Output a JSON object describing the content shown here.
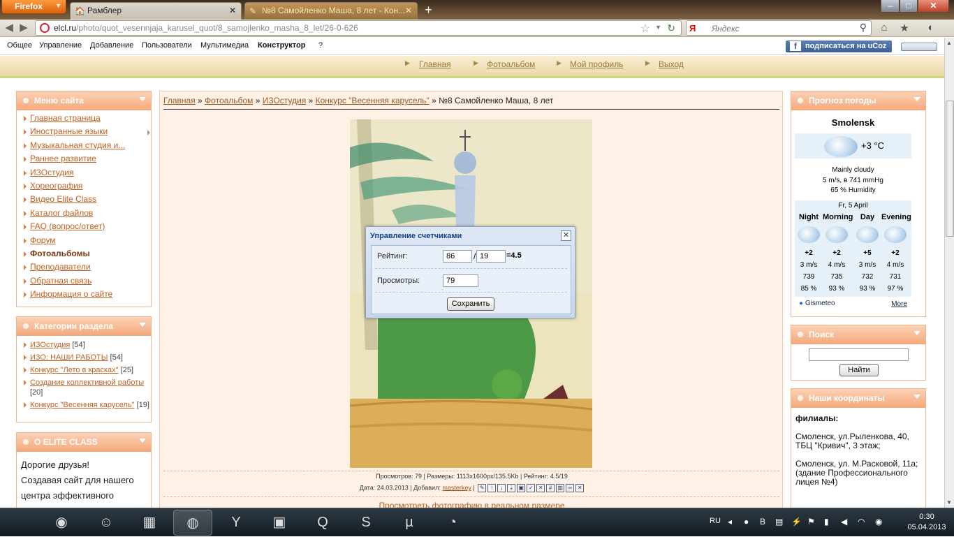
{
  "browser": {
    "menu_button": "Firefox",
    "tabs": [
      {
        "title": "Рамблер",
        "active": false
      },
      {
        "title": "№8 Самойленко Маша, 8 лет - Кон...",
        "active": true
      }
    ],
    "url_domain": "elcl.ru",
    "url_path": "/photo/quot_vesennjaja_karusel_quot/8_samojlenko_masha_8_let/26-0-626",
    "search_placeholder": "Яндекс",
    "search_engine_logo": "Я"
  },
  "ucoz_bar": {
    "items": [
      "Общее",
      "Управление",
      "Добавление",
      "Пользователи",
      "Мультимедиа",
      "Конструктор",
      "?"
    ],
    "subscribe": "подписаться на uCoz"
  },
  "site_nav": [
    "Главная",
    "Фотоальбом",
    "Мой профиль",
    "Выход"
  ],
  "site_menu": {
    "title": "Меню сайта",
    "items": [
      "Главная страница",
      "Иностранные языки",
      "Музыкальная студия и...",
      "Раннее развитие",
      "ИЗОстудия",
      "Хореография",
      "Видео Elite Class",
      "Каталог файлов",
      "FAQ (вопрос/ответ)",
      "Форум",
      "Фотоальбомы",
      "Преподаватели",
      "Обратная связь",
      "Информация о сайте"
    ]
  },
  "categories": {
    "title": "Категории раздела",
    "items": [
      {
        "name": "ИЗОстудия",
        "count": "[54]"
      },
      {
        "name": "ИЗО: НАШИ РАБОТЫ",
        "count": "[54]"
      },
      {
        "name": "Конкурс \"Лето в красках\"",
        "count": "[25]"
      },
      {
        "name": "Создание коллективной работы",
        "count": "[20]"
      },
      {
        "name": "Конкурс \"Весенняя карусель\"",
        "count": "[19]"
      }
    ]
  },
  "about": {
    "title": "О ELITE CLASS",
    "text1": "Дорогие друзья!",
    "text2": "Создавая сайт для нашего",
    "text3": "центра эффективного"
  },
  "breadcrumb": {
    "items": [
      "Главная",
      "Фотоальбом",
      "ИЗОстудия",
      "Конкурс \"Весенняя карусель\""
    ],
    "current": "№8 Самойленко Маша, 8 лет",
    "sep": "»"
  },
  "photo_info": {
    "line1": "Просмотров: 79 | Размеры: 1113x1600px/135.5Kb | Рейтинг: 4.5/19",
    "date": "Дата: 24.03.2013 | Добавил: ",
    "user": "masterkey",
    "bar": " | ",
    "real_size": "Просмотреть фотографию в реальном размере"
  },
  "modal": {
    "title": "Управление счетчиками",
    "rating_label": "Рейтинг:",
    "rating_sum": "86",
    "slash": "/",
    "rating_votes": "19",
    "rating_result": "=4.5",
    "views_label": "Просмотры:",
    "views": "79",
    "save": "Сохранить",
    "close": "✕"
  },
  "weather": {
    "title": "Прогноз погоды",
    "city": "Smolensk",
    "temp": "+3 °C",
    "desc": "Mainly cloudy",
    "wind_pressure": "5 m/s, в  741 mmHg",
    "humidity": "65 % Humidity",
    "date": "Fr, 5 April",
    "periods": [
      {
        "name": "Night",
        "temp": "+2",
        "wind": "3 m/s",
        "pressure": "739",
        "humidity": "85 %"
      },
      {
        "name": "Morning",
        "temp": "+2",
        "wind": "4 m/s",
        "pressure": "735",
        "humidity": "93 %"
      },
      {
        "name": "Day",
        "temp": "+5",
        "wind": "3 m/s",
        "pressure": "732",
        "humidity": "93 %"
      },
      {
        "name": "Evening",
        "temp": "+2",
        "wind": "4 m/s",
        "pressure": "731",
        "humidity": "97 %"
      }
    ],
    "provider": "Gismeteo",
    "more": "More"
  },
  "search": {
    "title": "Поиск",
    "button": "Найти"
  },
  "coords": {
    "title": "Наши координаты",
    "heading": "филиалы:",
    "addr1": "Смоленск, ул.Рыленкова, 40, ТБЦ \"Кривич\", 3 этаж;",
    "addr2": "Смоленск, ул. М.Расковой, 11а;",
    "addr3": "(здание Профессионального лицея №4)"
  },
  "taskbar": {
    "lang": "RU",
    "time": "0:30",
    "date": "05.04.2013"
  }
}
